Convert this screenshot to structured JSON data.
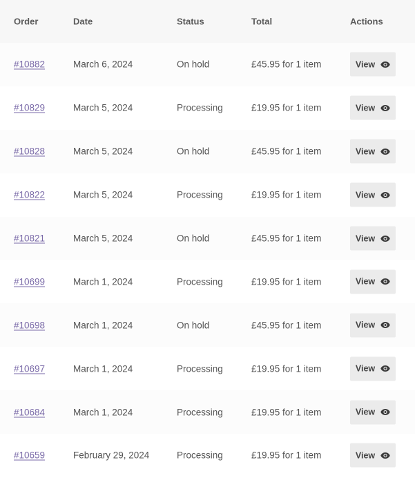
{
  "headers": {
    "order": "Order",
    "date": "Date",
    "status": "Status",
    "total": "Total",
    "actions": "Actions"
  },
  "view_label": "View",
  "orders": [
    {
      "number": "#10882",
      "date": "March 6, 2024",
      "status": "On hold",
      "total": "£45.95 for 1 item"
    },
    {
      "number": "#10829",
      "date": "March 5, 2024",
      "status": "Processing",
      "total": "£19.95 for 1 item"
    },
    {
      "number": "#10828",
      "date": "March 5, 2024",
      "status": "On hold",
      "total": "£45.95 for 1 item"
    },
    {
      "number": "#10822",
      "date": "March 5, 2024",
      "status": "Processing",
      "total": "£19.95 for 1 item"
    },
    {
      "number": "#10821",
      "date": "March 5, 2024",
      "status": "On hold",
      "total": "£45.95 for 1 item"
    },
    {
      "number": "#10699",
      "date": "March 1, 2024",
      "status": "Processing",
      "total": "£19.95 for 1 item"
    },
    {
      "number": "#10698",
      "date": "March 1, 2024",
      "status": "On hold",
      "total": "£45.95 for 1 item"
    },
    {
      "number": "#10697",
      "date": "March 1, 2024",
      "status": "Processing",
      "total": "£19.95 for 1 item"
    },
    {
      "number": "#10684",
      "date": "March 1, 2024",
      "status": "Processing",
      "total": "£19.95 for 1 item"
    },
    {
      "number": "#10659",
      "date": "February 29, 2024",
      "status": "Processing",
      "total": "£19.95 for 1 item"
    }
  ],
  "colors": {
    "link": "#7a6aa8",
    "button_bg": "#ebebeb",
    "header_bg": "#f7f7f7"
  },
  "icons": {
    "view": "eye-icon"
  }
}
